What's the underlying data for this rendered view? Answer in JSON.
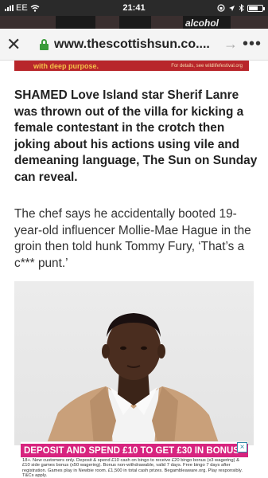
{
  "status_bar": {
    "carrier": "EE",
    "time": "21:41"
  },
  "background_ad": {
    "text": "alcohol"
  },
  "browser": {
    "close_icon": "close-icon",
    "url": "www.thescottishsun.co....",
    "forward_icon": "forward-arrow-icon",
    "menu_icon": "more-dots-icon"
  },
  "banner_ad": {
    "text": "with deep purpose.",
    "small": "For details, see wildlifefestival.org"
  },
  "article": {
    "lead": "SHAMED Love Island star Sherif Lanre was thrown out of the villa for kicking a female contestant in the crotch then joking about his actions using vile and demeaning language, The Sun on Sunday can reveal.",
    "paragraph": "The chef says he accidentally booted 19-year-old influencer Mollie-Mae Hague in the groin then told hunk Tommy Fury, ‘That’s a c*** punt.’"
  },
  "bottom_ad": {
    "headline": "DEPOSIT AND SPEND £10 TO GET £30 IN BONUS",
    "fine_print": "18+. New customers only. Deposit & spend £10 cash on bingo to receive £20 bingo bonus (x3 wagering) & £10 side games bonus (x50 wagering). Bonus non-withdrawable, valid 7 days. Free bingo 7 days after registration. Games play in Newbie room. £1,500 in total cash prizes. Begambleaware.org. Play responsibly. T&Cs apply.",
    "close_label": "×"
  },
  "colors": {
    "lock": "#3a9b3a",
    "banner": "#b8262b",
    "bonus": "#d7247f"
  }
}
